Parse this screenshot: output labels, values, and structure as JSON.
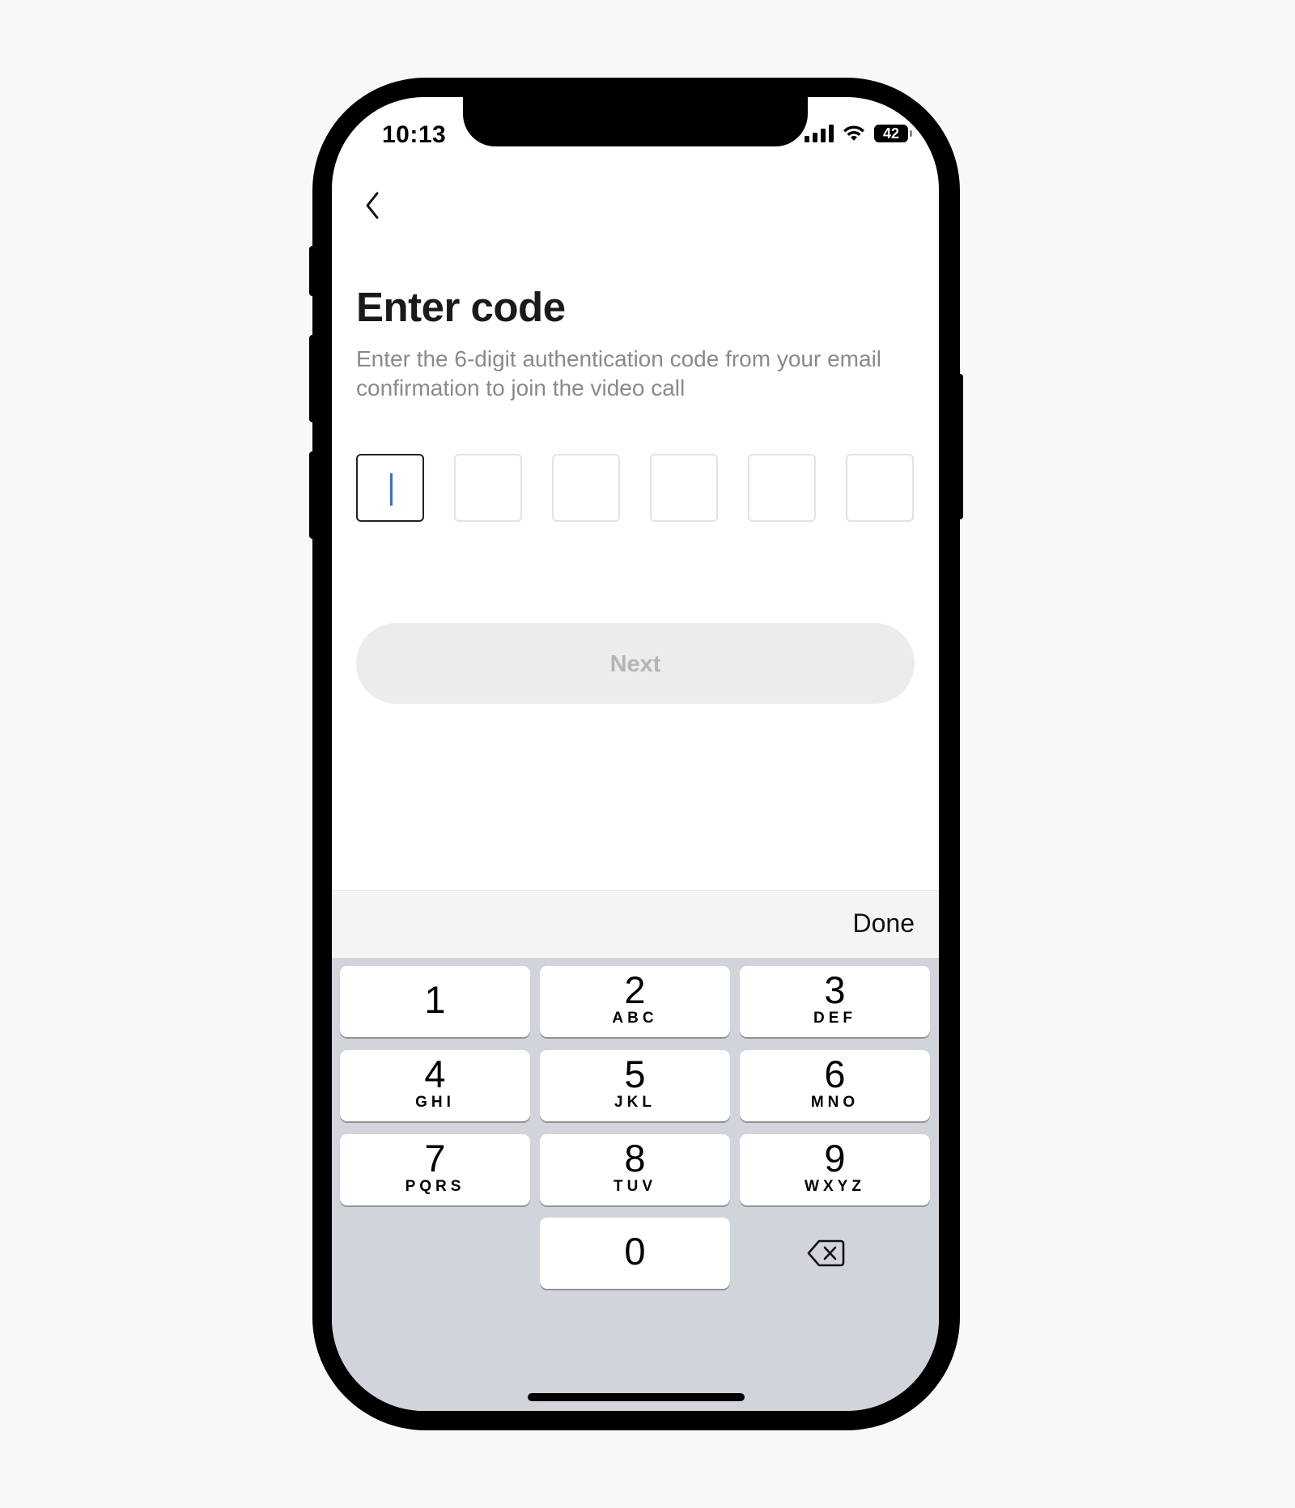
{
  "status_bar": {
    "time": "10:13",
    "battery": "42"
  },
  "header": {
    "back_icon": "chevron-left-icon"
  },
  "main": {
    "title": "Enter code",
    "subtitle": "Enter the 6-digit authentication code from your email confirmation to join the video call",
    "code_boxes": [
      "",
      "",
      "",
      "",
      "",
      ""
    ],
    "next_label": "Next"
  },
  "keyboard": {
    "done_label": "Done",
    "keys": [
      {
        "digit": "1",
        "letters": ""
      },
      {
        "digit": "2",
        "letters": "ABC"
      },
      {
        "digit": "3",
        "letters": "DEF"
      },
      {
        "digit": "4",
        "letters": "GHI"
      },
      {
        "digit": "5",
        "letters": "JKL"
      },
      {
        "digit": "6",
        "letters": "MNO"
      },
      {
        "digit": "7",
        "letters": "PQRS"
      },
      {
        "digit": "8",
        "letters": "TUV"
      },
      {
        "digit": "9",
        "letters": "WXYZ"
      },
      {
        "digit": "0",
        "letters": ""
      }
    ],
    "backspace_icon": "backspace-icon"
  },
  "colors": {
    "caret": "#2f6fde",
    "next_bg": "#ececec",
    "next_text": "#b5b5b5",
    "keyboard_bg": "#d1d4da"
  }
}
